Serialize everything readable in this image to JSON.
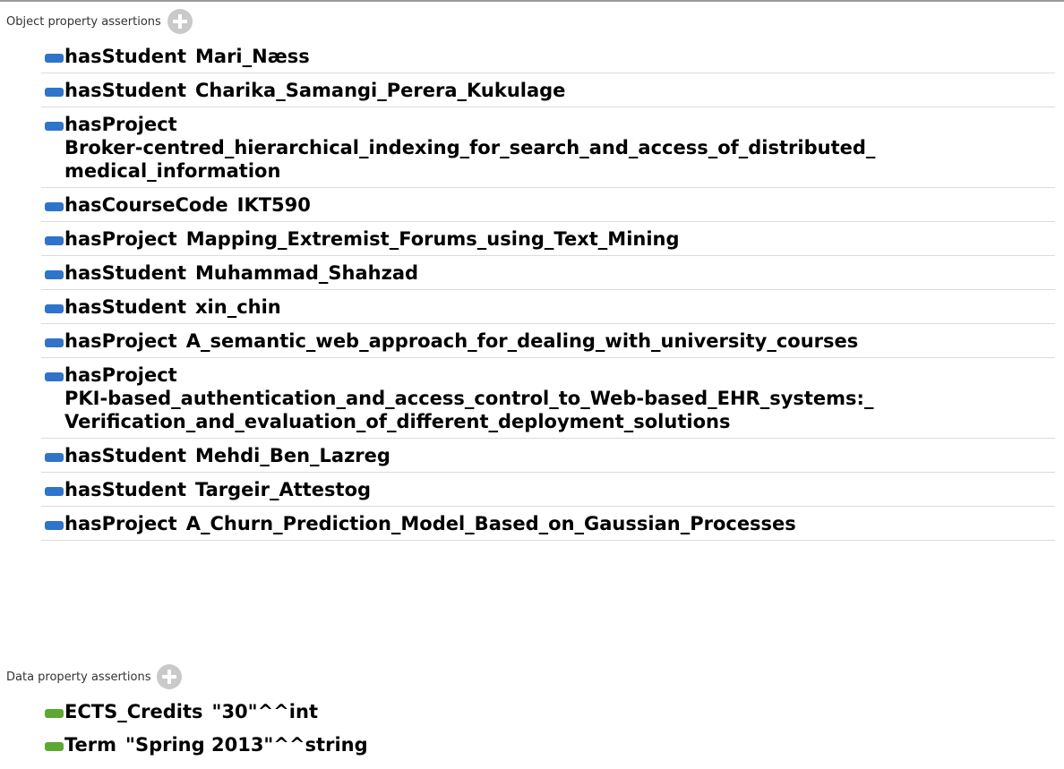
{
  "object_section": {
    "title": "Object property assertions",
    "add_icon": "plus-circle-icon",
    "swatch_color": "#2f74c9",
    "assertions": [
      {
        "property": "hasStudent",
        "value_lines": [
          "Mari_Næss"
        ]
      },
      {
        "property": "hasStudent",
        "value_lines": [
          "Charika_Samangi_Perera_Kukulage"
        ]
      },
      {
        "property": "hasProject",
        "value_lines": [
          "Broker-centred_hierarchical_indexing_for_search_and_access_of_distributed_",
          "medical_information"
        ]
      },
      {
        "property": "hasCourseCode",
        "value_lines": [
          "IKT590"
        ]
      },
      {
        "property": "hasProject",
        "value_lines": [
          "Mapping_Extremist_Forums_using_Text_Mining"
        ]
      },
      {
        "property": "hasStudent",
        "value_lines": [
          "Muhammad_Shahzad"
        ]
      },
      {
        "property": "hasStudent",
        "value_lines": [
          "xin_chin"
        ]
      },
      {
        "property": "hasProject",
        "value_lines": [
          "A_semantic_web_approach_for_dealing_with_university_courses"
        ]
      },
      {
        "property": "hasProject",
        "value_lines": [
          "PKI-based_authentication_and_access_control_to_Web-based_EHR_systems:_",
          "Verification_and_evaluation_of_different_deployment_solutions"
        ]
      },
      {
        "property": "hasStudent",
        "value_lines": [
          "Mehdi_Ben_Lazreg"
        ]
      },
      {
        "property": "hasStudent",
        "value_lines": [
          "Targeir_Attestog"
        ]
      },
      {
        "property": "hasProject",
        "value_lines": [
          "A_Churn_Prediction_Model_Based_on_Gaussian_Processes"
        ]
      }
    ]
  },
  "data_section": {
    "title": "Data property assertions",
    "add_icon": "plus-circle-icon",
    "swatch_color": "#5da832",
    "assertions": [
      {
        "property": "ECTS_Credits",
        "value_lines": [
          "\"30\"^^int"
        ]
      },
      {
        "property": "Term",
        "value_lines": [
          "\"Spring 2013\"^^string"
        ]
      }
    ]
  }
}
